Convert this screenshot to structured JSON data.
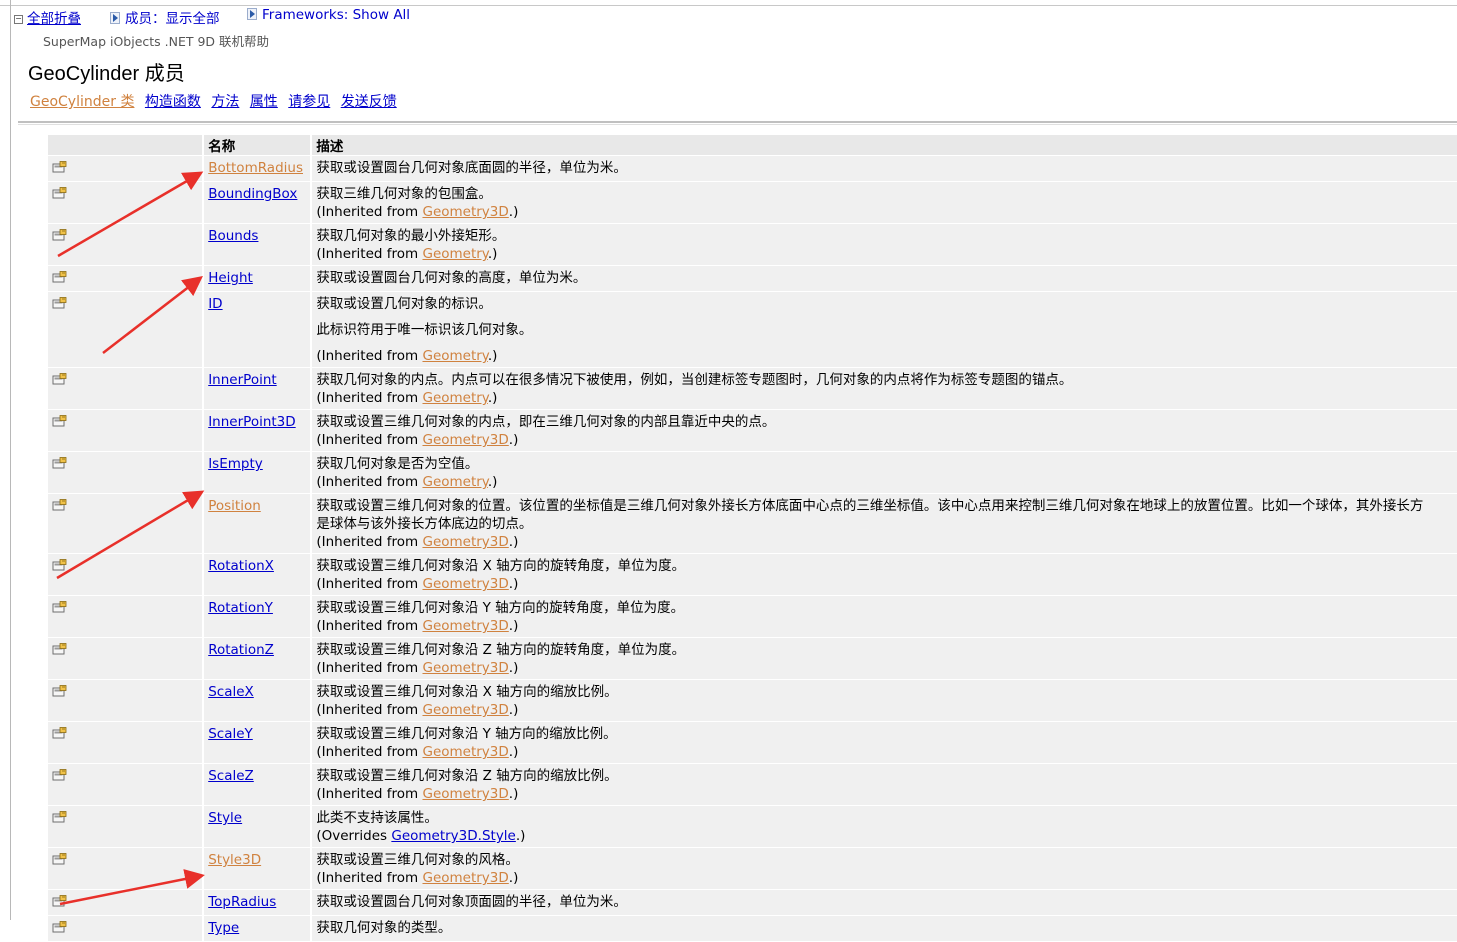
{
  "toolbar": {
    "collapse_all": "全部折叠",
    "members": "成员：显示全部",
    "frameworks": "Frameworks: Show All"
  },
  "header": {
    "subtitle": "SuperMap iObjects .NET 9D 联机帮助",
    "title": "GeoCylinder 成员"
  },
  "nav": {
    "links": [
      "GeoCylinder 类",
      "构造函数",
      "方法",
      "属性",
      "请参见",
      "发送反馈"
    ]
  },
  "table": {
    "headers": [
      "",
      "名称",
      "描述"
    ],
    "inherited_prefix": "(Inherited from ",
    "overrides_prefix": "(Overrides ",
    "suffix": ".)",
    "rows": [
      {
        "name": "BottomRadius",
        "visited": true,
        "desc": "获取或设置圆台几何对象底面圆的半径，单位为米。"
      },
      {
        "name": "BoundingBox",
        "desc": "获取三维几何对象的包围盒。",
        "from": "Geometry3D"
      },
      {
        "name": "Bounds",
        "desc": "获取几何对象的最小外接矩形。",
        "from": "Geometry"
      },
      {
        "name": "Height",
        "desc": "获取或设置圆台几何对象的高度，单位为米。"
      },
      {
        "name": "ID",
        "desc": "获取或设置几何对象的标识。",
        "para": "此标识符用于唯一标识该几何对象。",
        "from": "Geometry"
      },
      {
        "name": "InnerPoint",
        "desc": "获取几何对象的内点。内点可以在很多情况下被使用，例如，当创建标签专题图时，几何对象的内点将作为标签专题图的锚点。",
        "from": "Geometry"
      },
      {
        "name": "InnerPoint3D",
        "desc": "获取或设置三维几何对象的内点，即在三维几何对象的内部且靠近中央的点。",
        "from": "Geometry3D"
      },
      {
        "name": "IsEmpty",
        "desc": "获取几何对象是否为空值。",
        "from": "Geometry"
      },
      {
        "name": "Position",
        "visited": true,
        "desc": "获取或设置三维几何对象的位置。该位置的坐标值是三维几何对象外接长方体底面中心点的三维坐标值。该中心点用来控制三维几何对象在地球上的放置位置。比如一个球体，其外接长方",
        "desc2": "是球体与该外接长方体底边的切点。",
        "from": "Geometry3D"
      },
      {
        "name": "RotationX",
        "desc": "获取或设置三维几何对象沿 X 轴方向的旋转角度，单位为度。",
        "from": "Geometry3D"
      },
      {
        "name": "RotationY",
        "desc": "获取或设置三维几何对象沿 Y 轴方向的旋转角度，单位为度。",
        "from": "Geometry3D"
      },
      {
        "name": "RotationZ",
        "desc": "获取或设置三维几何对象沿 Z 轴方向的旋转角度，单位为度。",
        "from": "Geometry3D"
      },
      {
        "name": "ScaleX",
        "desc": "获取或设置三维几何对象沿 X 轴方向的缩放比例。",
        "from": "Geometry3D"
      },
      {
        "name": "ScaleY",
        "desc": "获取或设置三维几何对象沿 Y 轴方向的缩放比例。",
        "from": "Geometry3D"
      },
      {
        "name": "ScaleZ",
        "desc": "获取或设置三维几何对象沿 Z 轴方向的缩放比例。",
        "from": "Geometry3D"
      },
      {
        "name": "Style",
        "desc": "此类不支持该属性。",
        "overrides": "Geometry3D.Style"
      },
      {
        "name": "Style3D",
        "visited": true,
        "desc": "获取或设置三维几何对象的风格。",
        "from": "Geometry3D"
      },
      {
        "name": "TopRadius",
        "desc": "获取或设置圆台几何对象顶面圆的半径，单位为米。"
      },
      {
        "name": "Type",
        "desc": "获取几何对象的类型。"
      }
    ]
  },
  "colors": {
    "link": "#0000cc",
    "visited_link": "#d0823f",
    "annotation_arrow": "#e8302a"
  }
}
